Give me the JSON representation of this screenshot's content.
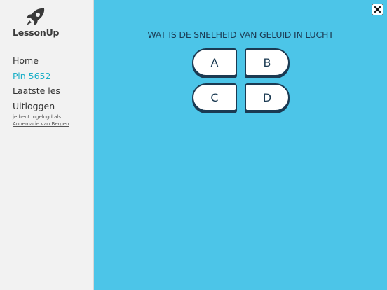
{
  "brand": {
    "name": "LessonUp",
    "logo_icon": "rocket-icon"
  },
  "nav": {
    "items": [
      {
        "label": "Home",
        "active": false
      },
      {
        "label": "Pin 5652",
        "active": true
      },
      {
        "label": "Laatste les",
        "active": false
      },
      {
        "label": "Uitloggen",
        "active": false
      }
    ]
  },
  "session": {
    "logged_in_text": "je bent ingelogd als",
    "user_name": "Annemarie van Bergen"
  },
  "quiz": {
    "question": "WAT IS DE SNELHEID VAN GELUID IN LUCHT",
    "answers": [
      "A",
      "B",
      "C",
      "D"
    ]
  },
  "colors": {
    "accent": "#1fb0c8",
    "main_background": "#4cc5e8",
    "sidebar_background": "#f2f2f2",
    "answer_border": "#1b3a52"
  }
}
